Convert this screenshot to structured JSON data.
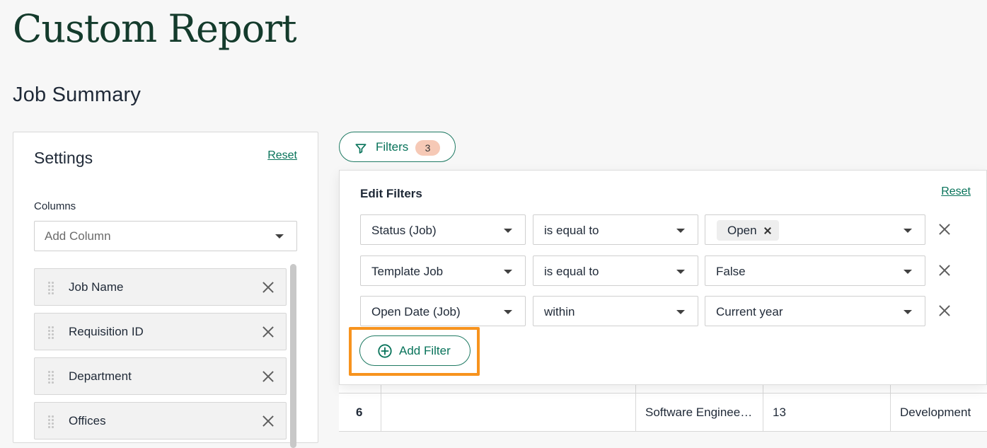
{
  "page": {
    "title": "Custom Report",
    "subtitle": "Job Summary"
  },
  "settings": {
    "title": "Settings",
    "reset_label": "Reset",
    "columns_label": "Columns",
    "add_column_placeholder": "Add Column",
    "columns": [
      {
        "label": "Job Name"
      },
      {
        "label": "Requisition ID"
      },
      {
        "label": "Department"
      },
      {
        "label": "Offices"
      }
    ]
  },
  "filters_button": {
    "label": "Filters",
    "count": "3"
  },
  "edit_filters": {
    "title": "Edit Filters",
    "reset_label": "Reset",
    "rows": [
      {
        "field": "Status (Job)",
        "operator": "is equal to",
        "value": "Open",
        "value_is_token": true
      },
      {
        "field": "Template Job",
        "operator": "is equal to",
        "value": "False",
        "value_is_token": false
      },
      {
        "field": "Open Date (Job)",
        "operator": "within",
        "value": "Current year",
        "value_is_token": false
      }
    ],
    "add_filter_label": "Add Filter"
  },
  "table": {
    "visible_row": {
      "index": "6",
      "blank_cell": "",
      "job_name": "Software Enginee…",
      "requisition_id": "13",
      "department": "Development"
    }
  },
  "colors": {
    "brand_green": "#08735a",
    "title_green": "#143b2c",
    "highlight_orange": "#f7931e",
    "count_badge": "#f6c9b6"
  },
  "icons": {
    "filters": "funnel-icon",
    "add_filter": "plus-circle-icon",
    "drag": "drag-handle-icon",
    "remove": "close-icon"
  }
}
